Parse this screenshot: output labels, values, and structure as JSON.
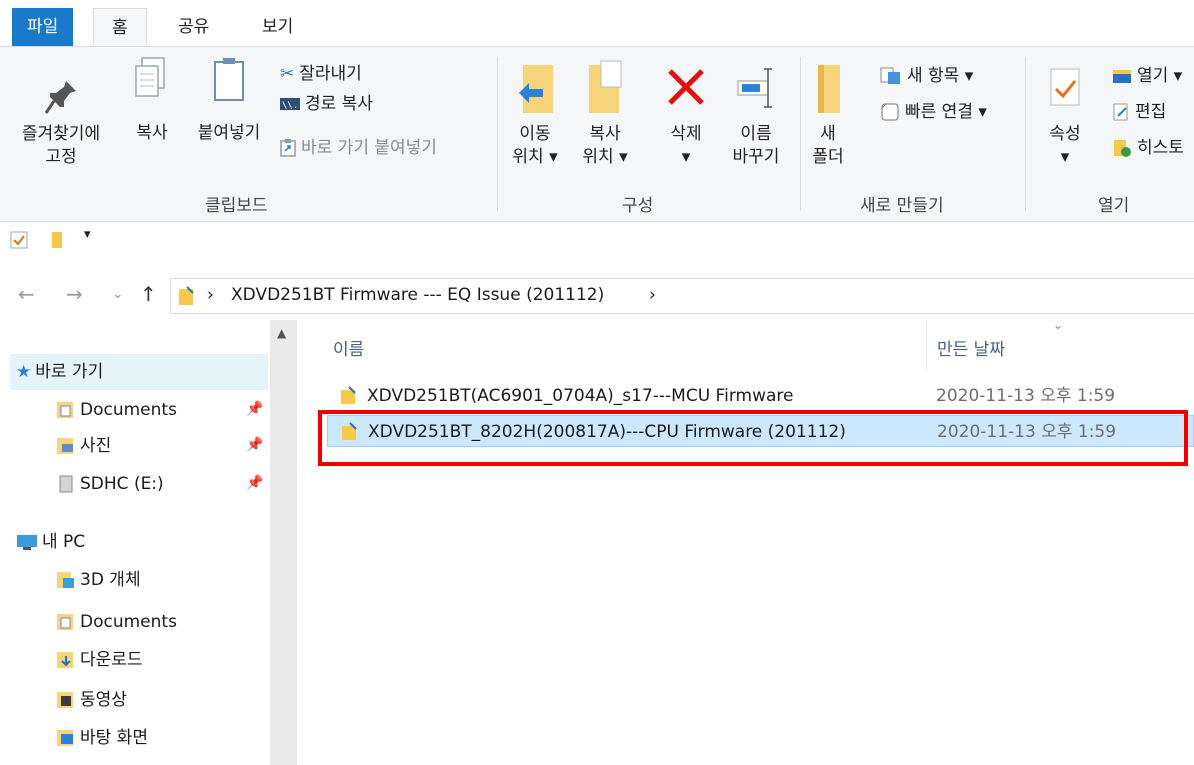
{
  "tabs": {
    "file": "파일",
    "home": "홈",
    "share": "공유",
    "view": "보기"
  },
  "clipboard": {
    "pin_line1": "즐겨찾기에",
    "pin_line2": "고정",
    "copy": "복사",
    "paste": "붙여넣기",
    "cut": "잘라내기",
    "copy_path": "경로 복사",
    "paste_shortcut": "바로 가기 붙여넣기",
    "group_label": "클립보드"
  },
  "organize": {
    "move_line1": "이동",
    "move_line2": "위치 ▾",
    "copyto_line1": "복사",
    "copyto_line2": "위치 ▾",
    "delete_line1": "삭제",
    "delete_line2": "▾",
    "rename_line1": "이름",
    "rename_line2": "바꾸기",
    "group_label": "구성"
  },
  "new": {
    "folder_line1": "새",
    "folder_line2": "폴더",
    "new_item": "새 항목 ▾",
    "easy_access": "빠른 연결 ▾",
    "group_label": "새로 만들기"
  },
  "open": {
    "props_line1": "속성",
    "props_line2": "▾",
    "open": "열기 ▾",
    "edit": "편집",
    "history": "히스토",
    "group_label": "열기"
  },
  "qat": {
    "dropdown": "▾"
  },
  "address": {
    "path": "XDVD251BT Firmware --- EQ Issue (201112)",
    "separator": "›",
    "end": "›"
  },
  "nav": {
    "quick_access": "바로 가기",
    "items": [
      {
        "label": "Documents"
      },
      {
        "label": "사진"
      },
      {
        "label": "SDHC (E:)"
      }
    ],
    "this_pc": "내 PC",
    "pc_items": [
      {
        "label": "3D 개체"
      },
      {
        "label": "Documents"
      },
      {
        "label": "다운로드"
      },
      {
        "label": "동영상"
      },
      {
        "label": "바탕 화면"
      }
    ]
  },
  "columns": {
    "name": "이름",
    "date": "만든 날짜"
  },
  "files": [
    {
      "name": "XDVD251BT(AC6901_0704A)_s17---MCU Firmware",
      "date": "2020-11-13 오후 1:59"
    },
    {
      "name": "XDVD251BT_8202H(200817A)---CPU Firmware (201112)",
      "date": "2020-11-13 오후 1:59"
    }
  ]
}
